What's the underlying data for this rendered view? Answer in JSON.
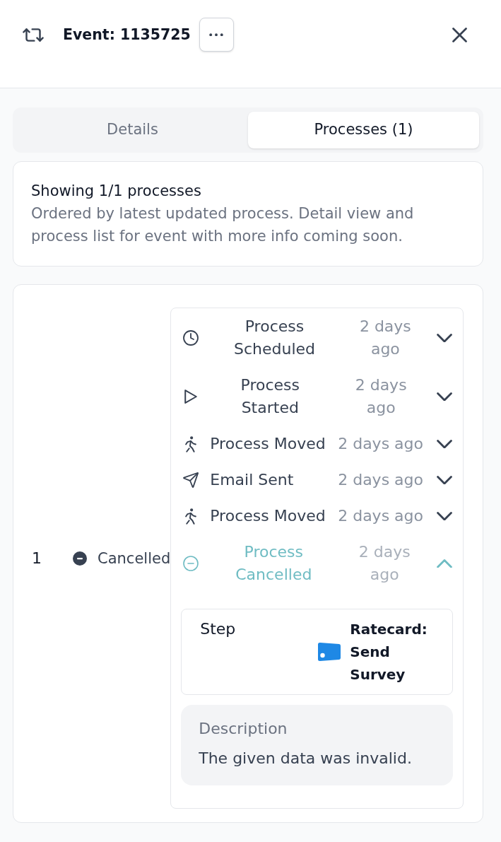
{
  "header": {
    "title": "Event: 1135725"
  },
  "tabs": [
    {
      "label": "Details",
      "selected": false
    },
    {
      "label": "Processes (1)",
      "selected": true
    }
  ],
  "summary": {
    "title": "Showing 1/1 processes",
    "description": "Ordered by latest updated process. Detail view and process list for event with more info coming soon."
  },
  "processes": [
    {
      "number": "1",
      "status": {
        "kind": "cancelled",
        "label": "Cancelled"
      },
      "events": [
        {
          "kind": "scheduled",
          "title": "Process Scheduled",
          "time": "2 days ago",
          "expanded": false
        },
        {
          "kind": "started",
          "title": "Process Started",
          "time": "2 days ago",
          "expanded": false
        },
        {
          "kind": "moved",
          "title": "Process Moved",
          "time": "2 days ago",
          "expanded": false
        },
        {
          "kind": "email",
          "title": "Email Sent",
          "time": "2 days ago",
          "expanded": false
        },
        {
          "kind": "moved",
          "title": "Process Moved",
          "time": "2 days ago",
          "expanded": false
        },
        {
          "kind": "cancelled",
          "title": "Process Cancelled",
          "time": "2 days ago",
          "expanded": true,
          "details": {
            "step_label": "Step",
            "step_value": "Ratecard: Send Survey",
            "description_label": "Description",
            "description": "The given data was invalid."
          }
        }
      ]
    }
  ]
}
